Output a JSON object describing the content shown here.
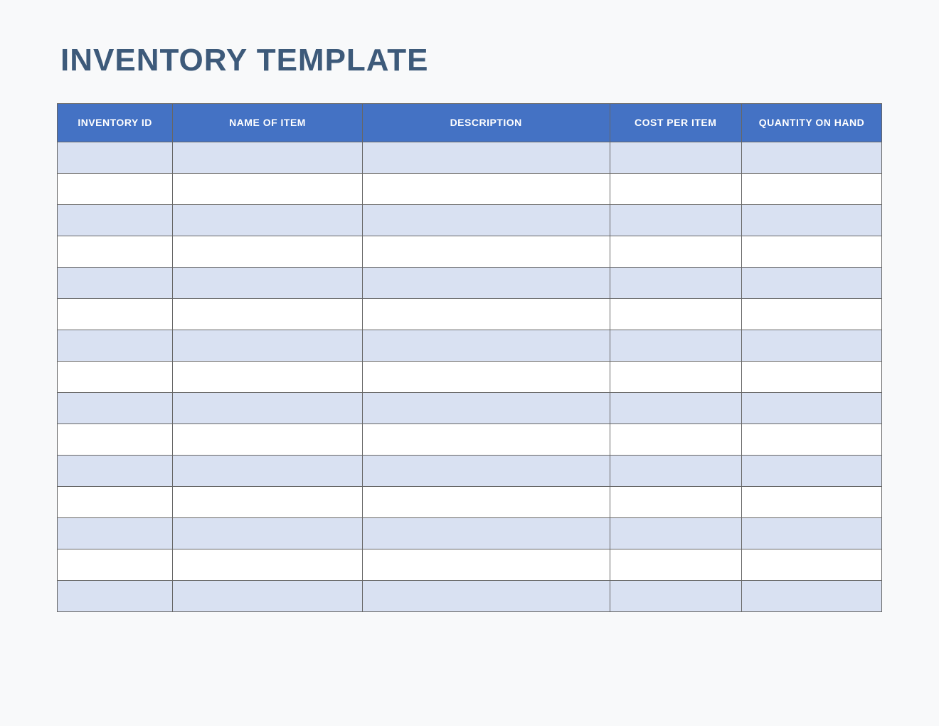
{
  "title": "INVENTORY TEMPLATE",
  "columns": [
    "INVENTORY ID",
    "NAME OF ITEM",
    "DESCRIPTION",
    "COST PER ITEM",
    "QUANTITY ON HAND"
  ],
  "rows": [
    {
      "inventory_id": "",
      "name_of_item": "",
      "description": "",
      "cost_per_item": "",
      "quantity_on_hand": ""
    },
    {
      "inventory_id": "",
      "name_of_item": "",
      "description": "",
      "cost_per_item": "",
      "quantity_on_hand": ""
    },
    {
      "inventory_id": "",
      "name_of_item": "",
      "description": "",
      "cost_per_item": "",
      "quantity_on_hand": ""
    },
    {
      "inventory_id": "",
      "name_of_item": "",
      "description": "",
      "cost_per_item": "",
      "quantity_on_hand": ""
    },
    {
      "inventory_id": "",
      "name_of_item": "",
      "description": "",
      "cost_per_item": "",
      "quantity_on_hand": ""
    },
    {
      "inventory_id": "",
      "name_of_item": "",
      "description": "",
      "cost_per_item": "",
      "quantity_on_hand": ""
    },
    {
      "inventory_id": "",
      "name_of_item": "",
      "description": "",
      "cost_per_item": "",
      "quantity_on_hand": ""
    },
    {
      "inventory_id": "",
      "name_of_item": "",
      "description": "",
      "cost_per_item": "",
      "quantity_on_hand": ""
    },
    {
      "inventory_id": "",
      "name_of_item": "",
      "description": "",
      "cost_per_item": "",
      "quantity_on_hand": ""
    },
    {
      "inventory_id": "",
      "name_of_item": "",
      "description": "",
      "cost_per_item": "",
      "quantity_on_hand": ""
    },
    {
      "inventory_id": "",
      "name_of_item": "",
      "description": "",
      "cost_per_item": "",
      "quantity_on_hand": ""
    },
    {
      "inventory_id": "",
      "name_of_item": "",
      "description": "",
      "cost_per_item": "",
      "quantity_on_hand": ""
    },
    {
      "inventory_id": "",
      "name_of_item": "",
      "description": "",
      "cost_per_item": "",
      "quantity_on_hand": ""
    },
    {
      "inventory_id": "",
      "name_of_item": "",
      "description": "",
      "cost_per_item": "",
      "quantity_on_hand": ""
    },
    {
      "inventory_id": "",
      "name_of_item": "",
      "description": "",
      "cost_per_item": "",
      "quantity_on_hand": ""
    }
  ],
  "colors": {
    "header_bg": "#4472c4",
    "title_color": "#3d5a7a",
    "odd_row_bg": "#d9e1f2",
    "even_row_bg": "#ffffff",
    "border": "#666666"
  }
}
